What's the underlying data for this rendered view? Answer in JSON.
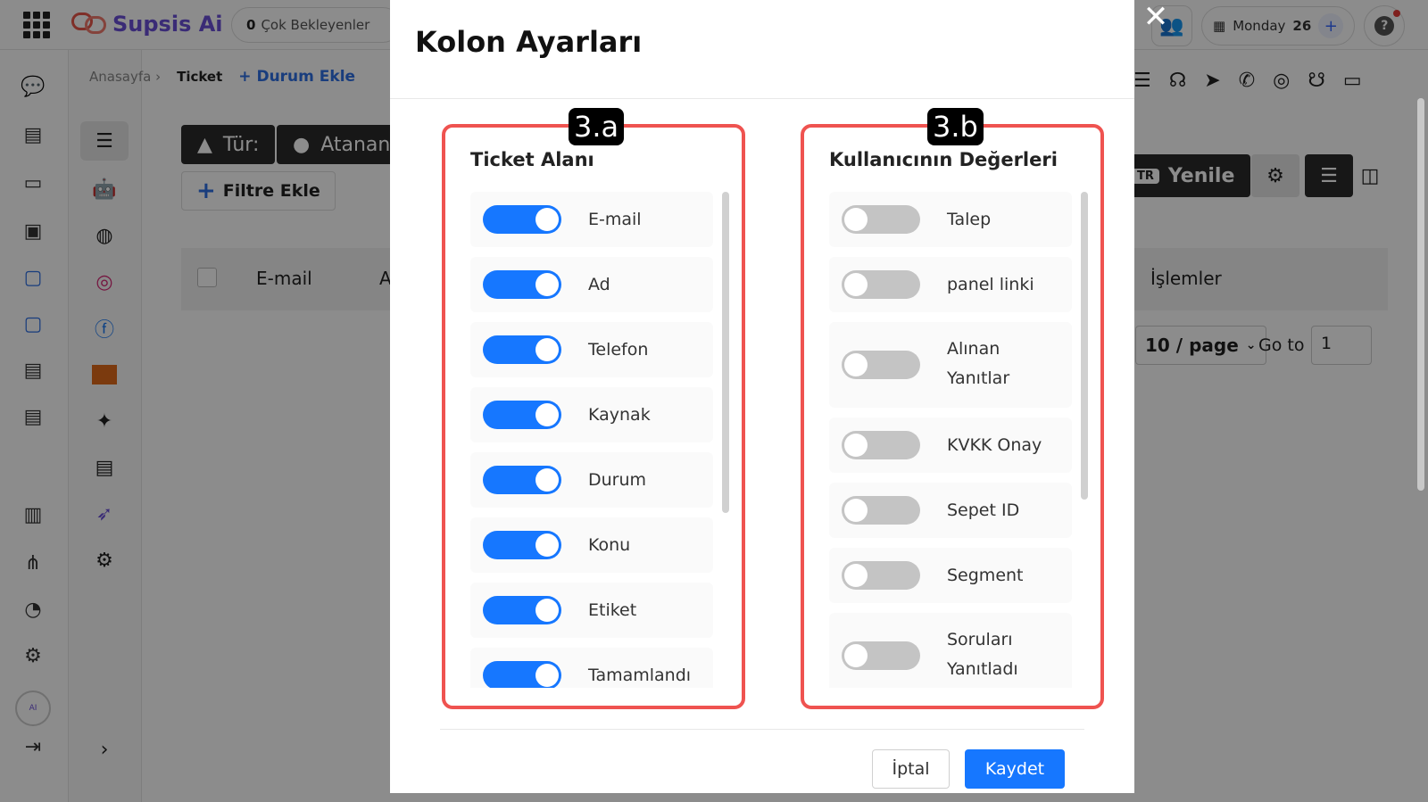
{
  "app": {
    "brand": "Supsis Ai",
    "pending": {
      "count": "0",
      "label": "Çok Bekleyenler"
    },
    "date": {
      "day": "Monday",
      "number": "26"
    },
    "help": "?"
  },
  "breadcrumb": {
    "home": "Anasayfa ›",
    "current": "Ticket",
    "add_status": "Durum Ekle"
  },
  "filters": {
    "type_label": "Tür:",
    "assignee_label": "Atanan",
    "add_filter": "Filtre Ekle"
  },
  "table": {
    "col_email": "E-mail",
    "col_a": "A",
    "col_actions": "İşlemler"
  },
  "toolbar": {
    "refresh": "Yenile",
    "refresh_tag": "TR"
  },
  "pagination": {
    "page_size": "10 / page",
    "goto_label": "Go to",
    "goto_value": "1"
  },
  "modal": {
    "title": "Kolon Ayarları",
    "left_panel": {
      "badge": "3.a",
      "title": "Ticket Alanı",
      "items": [
        {
          "label": "E-mail",
          "on": true
        },
        {
          "label": "Ad",
          "on": true
        },
        {
          "label": "Telefon",
          "on": true
        },
        {
          "label": "Kaynak",
          "on": true
        },
        {
          "label": "Durum",
          "on": true
        },
        {
          "label": "Konu",
          "on": true
        },
        {
          "label": "Etiket",
          "on": true
        },
        {
          "label": "Tamamlandı",
          "on": true
        }
      ]
    },
    "right_panel": {
      "badge": "3.b",
      "title": "Kullanıcının Değerleri",
      "items": [
        {
          "label": "Talep",
          "on": false
        },
        {
          "label": "panel linki",
          "on": false
        },
        {
          "label": "Alınan Yanıtlar",
          "on": false
        },
        {
          "label": "KVKK Onay",
          "on": false
        },
        {
          "label": "Sepet ID",
          "on": false
        },
        {
          "label": "Segment",
          "on": false
        },
        {
          "label": "Soruları Yanıtladı",
          "on": false
        }
      ]
    },
    "cancel": "İptal",
    "save": "Kaydet"
  },
  "colors": {
    "accent": "#1677ff",
    "highlight": "#ef5350",
    "brand": "#6b4fd8",
    "toggle_off": "#c4c4c4"
  },
  "icons": {
    "rail": [
      "chat-icon",
      "contact-card-icon",
      "inbox-icon",
      "report-icon",
      "window-icon",
      "window-icon",
      "layout-icon",
      "layout-icon",
      "dashboard-icon",
      "hierarchy-icon",
      "clock-icon",
      "settings-icon"
    ],
    "sub_rail": [
      "ticket-icon",
      "bot-icon",
      "globe-icon",
      "instagram-icon",
      "facebook-icon",
      "trendyol-icon",
      "sparkle-icon",
      "document-icon",
      "rocket-icon",
      "gear-icon"
    ]
  }
}
